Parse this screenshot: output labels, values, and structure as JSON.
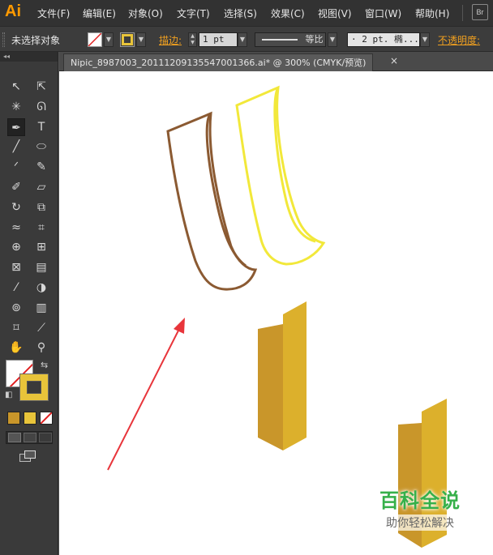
{
  "app": {
    "logo": "Ai",
    "bridge_label": "Br"
  },
  "menu": {
    "items": [
      {
        "label": "文件(F)"
      },
      {
        "label": "编辑(E)"
      },
      {
        "label": "对象(O)"
      },
      {
        "label": "文字(T)"
      },
      {
        "label": "选择(S)"
      },
      {
        "label": "效果(C)"
      },
      {
        "label": "视图(V)"
      },
      {
        "label": "窗口(W)"
      },
      {
        "label": "帮助(H)"
      }
    ]
  },
  "control": {
    "selection_label": "未选择对象",
    "stroke_label": "描边:",
    "stroke_weight": "1 pt",
    "stroke_style": "等比",
    "brush_def": "· 2 pt. 椭...",
    "opacity_label": "不透明度:"
  },
  "document": {
    "tab_title": "Nipic_8987003_20111209135547001366.ai* @ 300% (CMYK/预览)",
    "close_glyph": "×"
  },
  "tools": {
    "collapse_glyph": "◂◂",
    "items": [
      {
        "name": "selection-tool",
        "glyph": "↖"
      },
      {
        "name": "direct-selection-tool",
        "glyph": "⇱"
      },
      {
        "name": "magic-wand-tool",
        "glyph": "✳"
      },
      {
        "name": "lasso-tool",
        "glyph": "ᘏ"
      },
      {
        "name": "pen-tool",
        "glyph": "✒"
      },
      {
        "name": "type-tool",
        "glyph": "T"
      },
      {
        "name": "line-tool",
        "glyph": "╱"
      },
      {
        "name": "ellipse-tool",
        "glyph": "⬭"
      },
      {
        "name": "paintbrush-tool",
        "glyph": "ᐟ"
      },
      {
        "name": "pencil-tool",
        "glyph": "✎"
      },
      {
        "name": "blob-brush-tool",
        "glyph": "✐"
      },
      {
        "name": "eraser-tool",
        "glyph": "▱"
      },
      {
        "name": "rotate-tool",
        "glyph": "↻"
      },
      {
        "name": "scale-tool",
        "glyph": "⧉"
      },
      {
        "name": "width-tool",
        "glyph": "≈"
      },
      {
        "name": "free-transform-tool",
        "glyph": "⌗"
      },
      {
        "name": "shape-builder-tool",
        "glyph": "⊕"
      },
      {
        "name": "perspective-grid-tool",
        "glyph": "⊞"
      },
      {
        "name": "mesh-tool",
        "glyph": "⊠"
      },
      {
        "name": "gradient-tool",
        "glyph": "▤"
      },
      {
        "name": "eyedropper-tool",
        "glyph": "⁄"
      },
      {
        "name": "blend-tool",
        "glyph": "◑"
      },
      {
        "name": "symbol-sprayer-tool",
        "glyph": "⊚"
      },
      {
        "name": "column-graph-tool",
        "glyph": "▥"
      },
      {
        "name": "artboard-tool",
        "glyph": "⌑"
      },
      {
        "name": "slice-tool",
        "glyph": "⟋"
      },
      {
        "name": "hand-tool",
        "glyph": "✋"
      },
      {
        "name": "zoom-tool",
        "glyph": "⚲"
      }
    ],
    "swap_glyph": "⇆",
    "default_glyph": "◧"
  },
  "colors": {
    "brown_stroke": "#8b5a32",
    "yellow_stroke": "#f2e83a",
    "gold_front": "#c9962a",
    "gold_back": "#dcb02c",
    "arrow_red": "#e8353b"
  },
  "watermark": {
    "title": "百科全说",
    "subtitle": "助你轻松解决"
  }
}
